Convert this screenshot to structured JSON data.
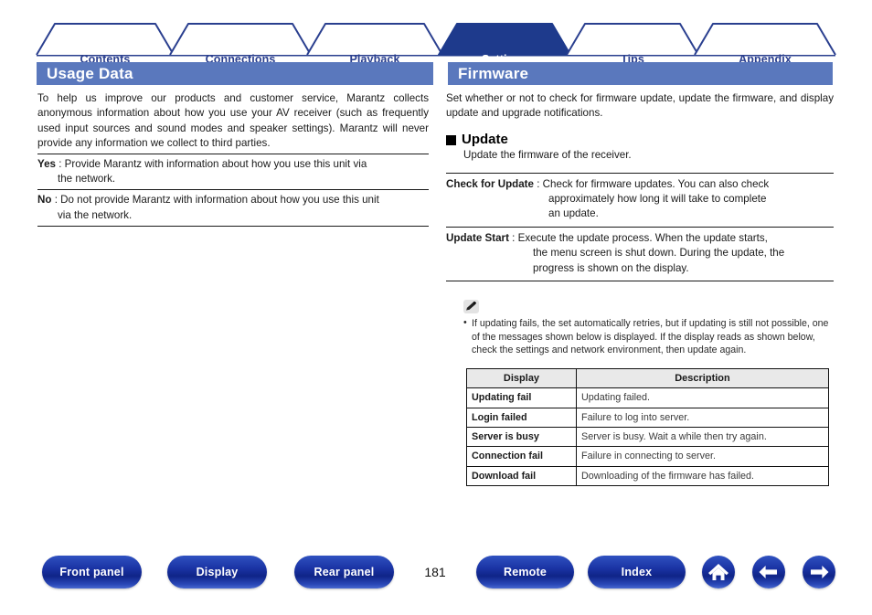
{
  "tabs": [
    {
      "label": "Contents",
      "active": false
    },
    {
      "label": "Connections",
      "active": false
    },
    {
      "label": "Playback",
      "active": false
    },
    {
      "label": "Settings",
      "active": true
    },
    {
      "label": "Tips",
      "active": false
    },
    {
      "label": "Appendix",
      "active": false
    }
  ],
  "left": {
    "section_title": "Usage Data",
    "intro": "To help us improve our products and customer service, Marantz collects anonymous information about how you use your AV receiver (such as frequently used input sources and sound modes and speaker settings). Marantz will never provide any information we collect to third parties.",
    "options": [
      {
        "term": "Yes",
        "colon": " : ",
        "line1": "Provide Marantz with information about how you use this unit via",
        "line2": "the network."
      },
      {
        "term": "No",
        "colon": " : ",
        "line1": "Do not provide Marantz with information about how you use this unit",
        "line2": "via the network."
      }
    ]
  },
  "right": {
    "section_title": "Firmware",
    "intro": "Set whether or not to check for firmware update, update the firmware, and display update and upgrade notifications.",
    "subhead": "Update",
    "subhead_desc": "Update the firmware of the receiver.",
    "items": [
      {
        "term": "Check for Update",
        "colon": " : ",
        "line1": "Check for firmware updates. You can also check",
        "line2": "approximately how long it will take to complete",
        "line3": "an update."
      },
      {
        "term": "Update Start",
        "colon": " : ",
        "line1": "Execute the update process. When the update starts,",
        "line2": "the menu screen is shut down. During the update, the",
        "line3": "progress is shown on the display."
      }
    ],
    "note": {
      "icon": "pencil-icon",
      "bullets": [
        "If updating fails, the set automatically retries, but if updating is still not possible, one of the messages shown below is displayed. If the display reads as shown below, check the settings and network environment, then update again."
      ]
    },
    "table": {
      "headers": [
        "Display",
        "Description"
      ],
      "rows": [
        [
          "Updating fail",
          "Updating failed."
        ],
        [
          "Login failed",
          "Failure to log into server."
        ],
        [
          "Server is busy",
          "Server is busy. Wait a while then try again."
        ],
        [
          "Connection fail",
          "Failure in connecting to server."
        ],
        [
          "Download fail",
          "Downloading of the firmware has failed."
        ]
      ]
    }
  },
  "footer": {
    "buttons": [
      {
        "label": "Front panel"
      },
      {
        "label": "Display"
      },
      {
        "label": "Rear panel"
      },
      {
        "label": "Remote"
      },
      {
        "label": "Index"
      }
    ],
    "page_number": "181",
    "icons": [
      "home-icon",
      "back-arrow-icon",
      "forward-arrow-icon"
    ]
  },
  "colors": {
    "tab_active_bg": "#1e3a8c",
    "tab_outline": "#2a3f8f",
    "section_bar": "#5a78bd",
    "button_blue": "#16308f",
    "table_header_bg": "#e9e9e9"
  }
}
